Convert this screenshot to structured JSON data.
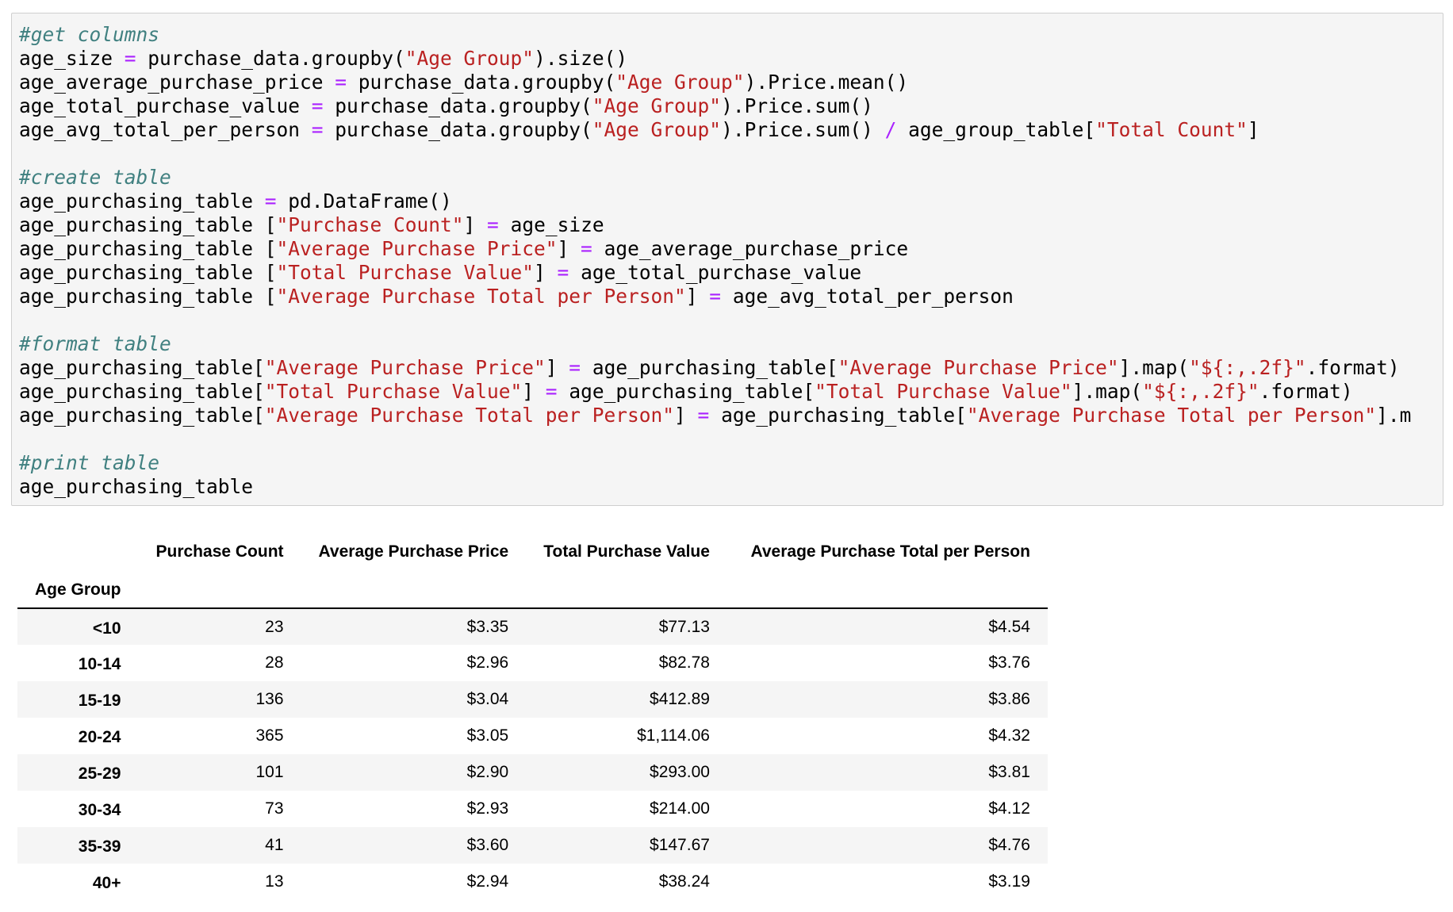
{
  "code_cell": {
    "comments": {
      "get_columns": "#get columns",
      "create_table": "#create table",
      "format_table": "#format table",
      "print_table": "#print table"
    },
    "tokens": {
      "l2a": "age_size ",
      "l2op": "=",
      "l2b": " purchase_data.groupby(",
      "l2s": "\"Age Group\"",
      "l2c": ").size()",
      "l3a": "age_average_purchase_price ",
      "l3op": "=",
      "l3b": " purchase_data.groupby(",
      "l3s": "\"Age Group\"",
      "l3c": ").Price.mean()",
      "l4a": "age_total_purchase_value ",
      "l4op": "=",
      "l4b": " purchase_data.groupby(",
      "l4s": "\"Age Group\"",
      "l4c": ").Price.sum()",
      "l5a": "age_avg_total_per_person ",
      "l5op": "=",
      "l5b": " purchase_data.groupby(",
      "l5s": "\"Age Group\"",
      "l5c": ").Price.sum() ",
      "l5op2": "/",
      "l5d": " age_group_table[",
      "l5s2": "\"Total Count\"",
      "l5e": "]",
      "l8a": "age_purchasing_table ",
      "l8op": "=",
      "l8b": " pd.DataFrame()",
      "l9a": "age_purchasing_table [",
      "l9s": "\"Purchase Count\"",
      "l9b": "] ",
      "l9op": "=",
      "l9c": " age_size",
      "l10a": "age_purchasing_table [",
      "l10s": "\"Average Purchase Price\"",
      "l10b": "] ",
      "l10op": "=",
      "l10c": " age_average_purchase_price",
      "l11a": "age_purchasing_table [",
      "l11s": "\"Total Purchase Value\"",
      "l11b": "] ",
      "l11op": "=",
      "l11c": " age_total_purchase_value",
      "l12a": "age_purchasing_table [",
      "l12s": "\"Average Purchase Total per Person\"",
      "l12b": "] ",
      "l12op": "=",
      "l12c": " age_avg_total_per_person",
      "l15a": "age_purchasing_table[",
      "l15s": "\"Average Purchase Price\"",
      "l15b": "] ",
      "l15op": "=",
      "l15c": " age_purchasing_table[",
      "l15s2": "\"Average Purchase Price\"",
      "l15d": "].map(",
      "l15s3": "\"${:,.2f}\"",
      "l15e": ".format)",
      "l16a": "age_purchasing_table[",
      "l16s": "\"Total Purchase Value\"",
      "l16b": "] ",
      "l16op": "=",
      "l16c": " age_purchasing_table[",
      "l16s2": "\"Total Purchase Value\"",
      "l16d": "].map(",
      "l16s3": "\"${:,.2f}\"",
      "l16e": ".format)",
      "l17a": "age_purchasing_table[",
      "l17s": "\"Average Purchase Total per Person\"",
      "l17b": "] ",
      "l17op": "=",
      "l17c": " age_purchasing_table[",
      "l17s2": "\"Average Purchase Total per Person\"",
      "l17d": "].m",
      "l20a": "age_purchasing_table"
    },
    "colors": {
      "comment": "#408080",
      "string": "#ba2121",
      "operator": "#aa22ff",
      "background": "#f5f5f5"
    }
  },
  "output_table": {
    "index_name": "Age Group",
    "columns": [
      "Purchase Count",
      "Average Purchase Price",
      "Total Purchase Value",
      "Average Purchase Total per Person"
    ],
    "rows": [
      {
        "label": "<10",
        "values": [
          "23",
          "$3.35",
          "$77.13",
          "$4.54"
        ]
      },
      {
        "label": "10-14",
        "values": [
          "28",
          "$2.96",
          "$82.78",
          "$3.76"
        ]
      },
      {
        "label": "15-19",
        "values": [
          "136",
          "$3.04",
          "$412.89",
          "$3.86"
        ]
      },
      {
        "label": "20-24",
        "values": [
          "365",
          "$3.05",
          "$1,114.06",
          "$4.32"
        ]
      },
      {
        "label": "25-29",
        "values": [
          "101",
          "$2.90",
          "$293.00",
          "$3.81"
        ]
      },
      {
        "label": "30-34",
        "values": [
          "73",
          "$2.93",
          "$214.00",
          "$4.12"
        ]
      },
      {
        "label": "35-39",
        "values": [
          "41",
          "$3.60",
          "$147.67",
          "$4.76"
        ]
      },
      {
        "label": "40+",
        "values": [
          "13",
          "$2.94",
          "$38.24",
          "$3.19"
        ]
      }
    ]
  }
}
